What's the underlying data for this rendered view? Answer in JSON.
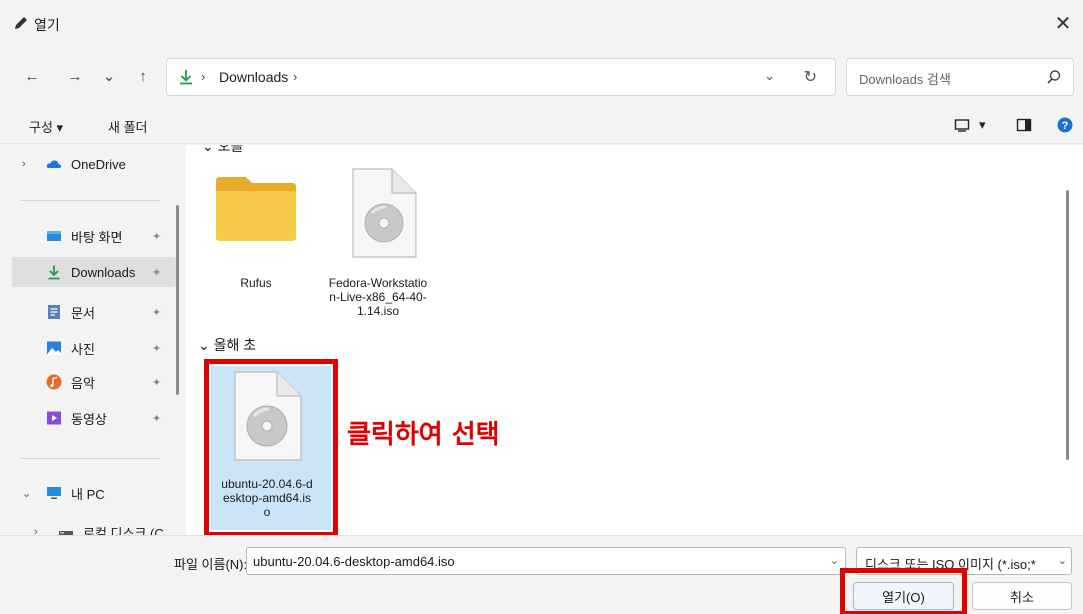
{
  "window": {
    "title": "열기",
    "close_glyph": "✕"
  },
  "nav": {
    "back_glyph": "←",
    "forward_glyph": "→",
    "recent_glyph": "⌄",
    "up_glyph": "↑",
    "breadcrumb_sep": "›",
    "breadcrumb_location": "Downloads",
    "dropdown_glyph": "⌄",
    "refresh_glyph": "↻",
    "search_placeholder": "Downloads 검색"
  },
  "commandbar": {
    "organize": "구성 ▾",
    "new_folder": "새 폴더",
    "view_dropdown": "▾"
  },
  "sidebar": {
    "expand_glyph": "›",
    "collapse_glyph": "⌄",
    "pin_glyph": "📌",
    "items": [
      {
        "label": "OneDrive",
        "icon": "cloud-icon",
        "color": "#1a73e8"
      },
      {
        "label": "바탕 화면",
        "icon": "desktop-icon",
        "color": "#2a8cd6"
      },
      {
        "label": "Downloads",
        "icon": "download-icon",
        "color": "#1e9b4a"
      },
      {
        "label": "문서",
        "icon": "document-icon",
        "color": "#5b7fb0"
      },
      {
        "label": "사진",
        "icon": "pictures-icon",
        "color": "#2a7fd6"
      },
      {
        "label": "음악",
        "icon": "music-icon",
        "color": "#e46b2c"
      },
      {
        "label": "동영상",
        "icon": "video-icon",
        "color": "#8a4ad6"
      },
      {
        "label": "내 PC",
        "icon": "pc-icon",
        "color": "#2a8cd6"
      },
      {
        "label": "로컬 디스크 (C",
        "icon": "drive-icon",
        "color": "#555555"
      }
    ]
  },
  "content": {
    "groups": [
      {
        "header": "⌄ 오늘",
        "collapse_glyph": "⌄"
      },
      {
        "header": "⌄ 올해 초"
      }
    ],
    "files": [
      {
        "name": "Rufus",
        "type": "folder"
      },
      {
        "name": "Fedora-Workstation-Live-x86_64-40-1.14.iso",
        "type": "disc-image"
      },
      {
        "name": "ubuntu-20.04.6-desktop-amd64.iso",
        "type": "disc-image",
        "selected": true
      }
    ],
    "annotation": "클릭하여 선택"
  },
  "bottom": {
    "filename_label": "파일 이름(N):",
    "filename_value": "ubuntu-20.04.6-desktop-amd64.iso",
    "filetype_value": "디스크 또는 ISO 이미지 (*.iso;*",
    "open_button": "열기(O)",
    "cancel_button": "취소"
  },
  "colors": {
    "accent": "#0067c0",
    "highlight_red": "#e00000",
    "selection": "#cce4f7",
    "download_green": "#1e9b4a",
    "folder_yellow": "#f7c948"
  }
}
